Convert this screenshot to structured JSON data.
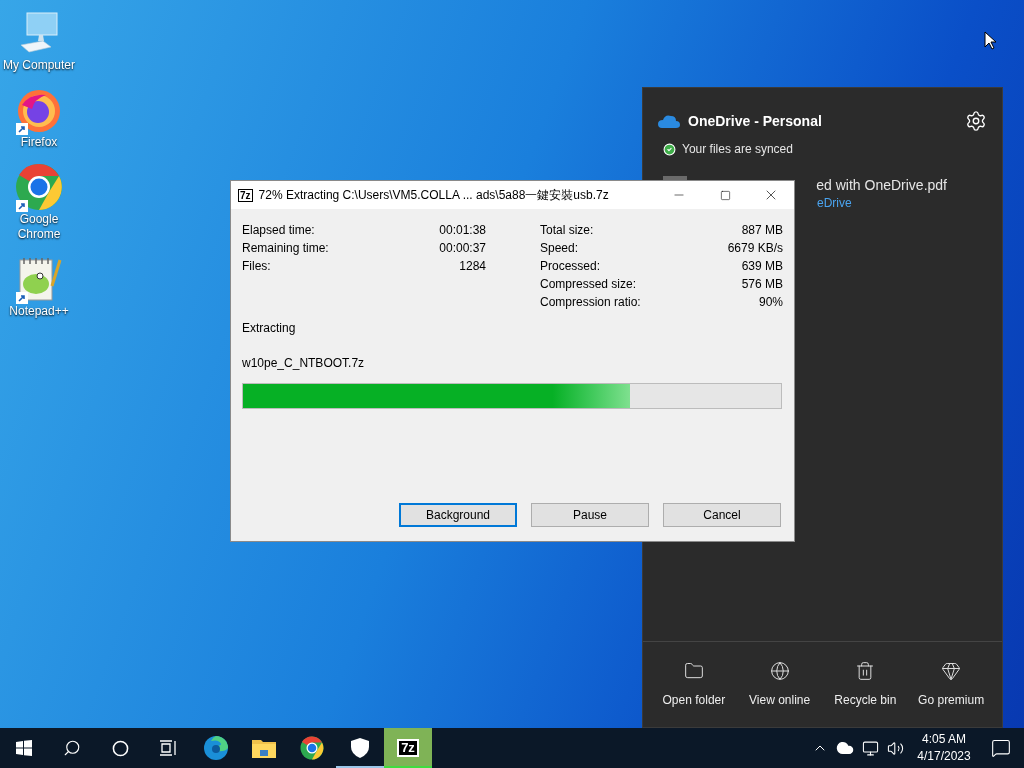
{
  "desktop_icons": [
    {
      "label": "My Computer",
      "kind": "computer",
      "shortcut": false
    },
    {
      "label": "Firefox",
      "kind": "firefox",
      "shortcut": true
    },
    {
      "label": "Google Chrome",
      "kind": "chrome",
      "shortcut": true
    },
    {
      "label": "Notepad++",
      "kind": "notepad",
      "shortcut": true
    }
  ],
  "onedrive": {
    "title": "OneDrive - Personal",
    "status": "Your files are synced",
    "file_name": "ed with OneDrive.pdf",
    "file_link": "eDrive",
    "actions": [
      {
        "label": "Open folder",
        "kind": "folder"
      },
      {
        "label": "View online",
        "kind": "globe"
      },
      {
        "label": "Recycle bin",
        "kind": "bin"
      },
      {
        "label": "Go premium",
        "kind": "gem"
      }
    ]
  },
  "dialog": {
    "icon": "7z",
    "title": "72% Extracting C:\\Users\\VM5.COLLA ... ads\\5a88一鍵安裝usb.7z",
    "left_stats": [
      {
        "label": "Elapsed time:",
        "value": "00:01:38"
      },
      {
        "label": "Remaining time:",
        "value": "00:00:37"
      },
      {
        "label": "Files:",
        "value": "1284"
      }
    ],
    "right_stats": [
      {
        "label": "Total size:",
        "value": "887 MB"
      },
      {
        "label": "Speed:",
        "value": "6679 KB/s"
      },
      {
        "label": "Processed:",
        "value": "639 MB"
      },
      {
        "label": "Compressed size:",
        "value": "576 MB"
      },
      {
        "label": "Compression ratio:",
        "value": "90%"
      }
    ],
    "status": "Extracting",
    "file": "w10pe_C_NTBOOT.7z",
    "progress": {
      "level": 0.72
    },
    "buttons": [
      {
        "label": "Background",
        "focused": true
      },
      {
        "label": "Pause",
        "focused": false
      },
      {
        "label": "Cancel",
        "focused": false
      }
    ]
  },
  "taskbar": {
    "apps": [
      {
        "kind": "edge",
        "running": false,
        "active": false
      },
      {
        "kind": "explorer",
        "running": false,
        "active": false
      },
      {
        "kind": "chrome",
        "running": false,
        "active": false
      },
      {
        "kind": "shield",
        "running": true,
        "active": false
      },
      {
        "kind": "sevenzip",
        "label": "7z",
        "running": true,
        "active": true
      }
    ],
    "clock": {
      "time": "4:05 AM",
      "date": "4/17/2023"
    }
  }
}
